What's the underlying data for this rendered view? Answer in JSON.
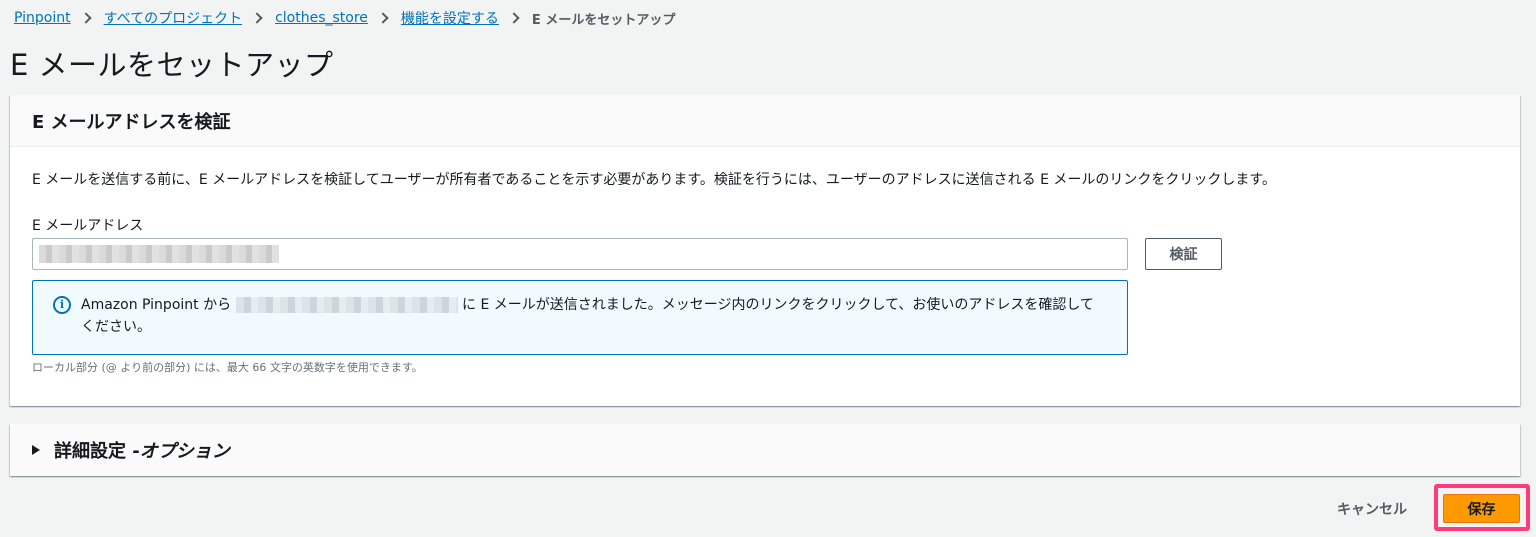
{
  "breadcrumb": {
    "items": [
      "Pinpoint",
      "すべてのプロジェクト",
      "clothes_store",
      "機能を設定する"
    ],
    "current": "E メールをセットアップ"
  },
  "page": {
    "title": "E メールをセットアップ"
  },
  "verify_panel": {
    "header": "E メールアドレスを検証",
    "description": "E メールを送信する前に、E メールアドレスを検証してユーザーが所有者であることを示す必要があります。検証を行うには、ユーザーのアドレスに送信される E メールのリンクをクリックします。",
    "email_label": "E メールアドレス",
    "verify_button": "検証",
    "info_prefix": "Amazon Pinpoint から",
    "info_suffix": "に E メールが送信されました。メッセージ内のリンクをクリックして、お使いのアドレスを確認してください。",
    "hint": "ローカル部分 (@ より前の部分) には、最大 66 文字の英数字を使用できます。"
  },
  "advanced": {
    "label_main": "詳細設定 - ",
    "label_italic": "オプション"
  },
  "footer": {
    "cancel": "キャンセル",
    "save": "保存"
  },
  "colors": {
    "link": "#0073bb",
    "primary": "#ff9900",
    "highlight": "#ff3b7f",
    "info_bg": "#f1faff"
  }
}
